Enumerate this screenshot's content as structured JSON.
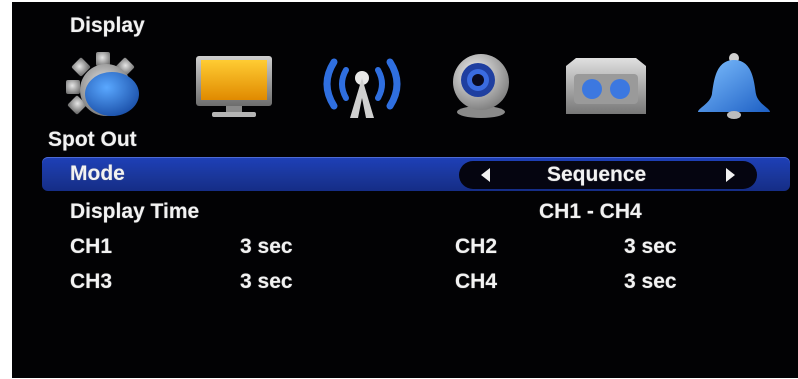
{
  "menu": {
    "title": "Display"
  },
  "icons": [
    {
      "name": "gear-icon"
    },
    {
      "name": "monitor-icon"
    },
    {
      "name": "network-antenna-icon"
    },
    {
      "name": "camera-icon"
    },
    {
      "name": "storage-icon"
    },
    {
      "name": "alarm-bell-icon"
    }
  ],
  "section": {
    "title": "Spot Out"
  },
  "mode": {
    "label": "Mode",
    "value": "Sequence"
  },
  "display_time": {
    "label": "Display Time",
    "range": "CH1 - CH4"
  },
  "channels": [
    {
      "label": "CH1",
      "value": "3 sec"
    },
    {
      "label": "CH2",
      "value": "3 sec"
    },
    {
      "label": "CH3",
      "value": "3 sec"
    },
    {
      "label": "CH4",
      "value": "3 sec"
    }
  ],
  "colors": {
    "highlight": "#1a3699",
    "background": "#020204",
    "text": "#f2f2f2"
  }
}
